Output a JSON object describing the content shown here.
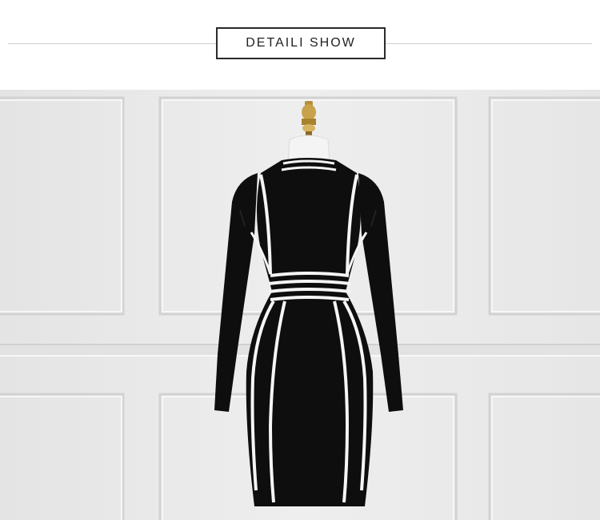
{
  "header": {
    "title": "DETAILI SHOW"
  },
  "photo": {
    "subject": "product-photo",
    "colors": {
      "wall": "#e9e9e9",
      "dress": "#0e0e0e",
      "stripe": "#f5f5f5",
      "finial": "#c8a24a"
    }
  }
}
